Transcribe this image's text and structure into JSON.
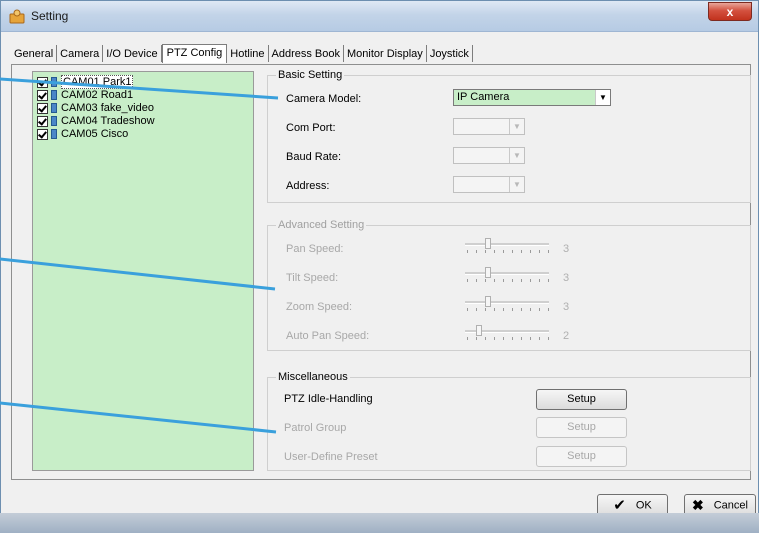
{
  "window": {
    "title": "Setting",
    "close_glyph": "x"
  },
  "tabs": [
    {
      "label": "General"
    },
    {
      "label": "Camera"
    },
    {
      "label": "I/O Device"
    },
    {
      "label": "PTZ Config"
    },
    {
      "label": "Hotline"
    },
    {
      "label": "Address Book"
    },
    {
      "label": "Monitor Display"
    },
    {
      "label": "Joystick"
    }
  ],
  "active_tab": "PTZ Config",
  "cameras": [
    {
      "label": "CAM01 Park1",
      "checked": true,
      "selected": true
    },
    {
      "label": "CAM02 Road1",
      "checked": true
    },
    {
      "label": "CAM03 fake_video",
      "checked": true
    },
    {
      "label": "CAM04 Tradeshow",
      "checked": true
    },
    {
      "label": "CAM05 Cisco",
      "checked": true
    }
  ],
  "basic": {
    "title": "Basic Setting",
    "camera_model_label": "Camera Model:",
    "camera_model_value": "IP Camera",
    "com_port_label": "Com Port:",
    "com_port_value": "",
    "baud_rate_label": "Baud Rate:",
    "baud_rate_value": "",
    "address_label": "Address:",
    "address_value": ""
  },
  "advanced": {
    "title": "Advanced Setting",
    "pan_label": "Pan Speed:",
    "pan_value": "3",
    "tilt_label": "Tilt Speed:",
    "tilt_value": "3",
    "zoom_label": "Zoom Speed:",
    "zoom_value": "3",
    "auto_pan_label": "Auto Pan Speed:",
    "auto_pan_value": "2"
  },
  "misc": {
    "title": "Miscellaneous",
    "idle_label": "PTZ Idle-Handling",
    "patrol_label": "Patrol Group",
    "preset_label": "User-Define Preset",
    "setup_label": "Setup"
  },
  "footer": {
    "ok_label": "OK",
    "cancel_label": "Cancel"
  },
  "colors": {
    "accent_green": "#c8eec8",
    "callout_blue": "#3aa0dc"
  }
}
